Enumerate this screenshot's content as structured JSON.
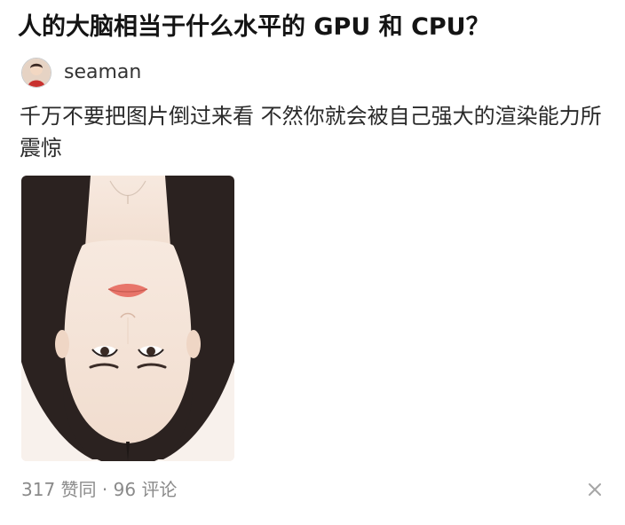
{
  "post": {
    "title": "人的大脑相当于什么水平的 GPU 和 CPU？",
    "author": {
      "name": "seaman",
      "avatar_icon": "avatar-image"
    },
    "content": "千万不要把图片倒过来看 不然你就会被自己强大的渲染能力所震惊",
    "stats": {
      "upvotes": "317",
      "upvote_label": "赞同",
      "separator": "·",
      "comments": "96",
      "comment_label": "评论"
    },
    "dismiss_icon": "close-icon"
  },
  "colors": {
    "title": "#141414",
    "body_text": "#2a2a2a",
    "meta_text": "#8a8a8a",
    "background": "#ffffff"
  }
}
